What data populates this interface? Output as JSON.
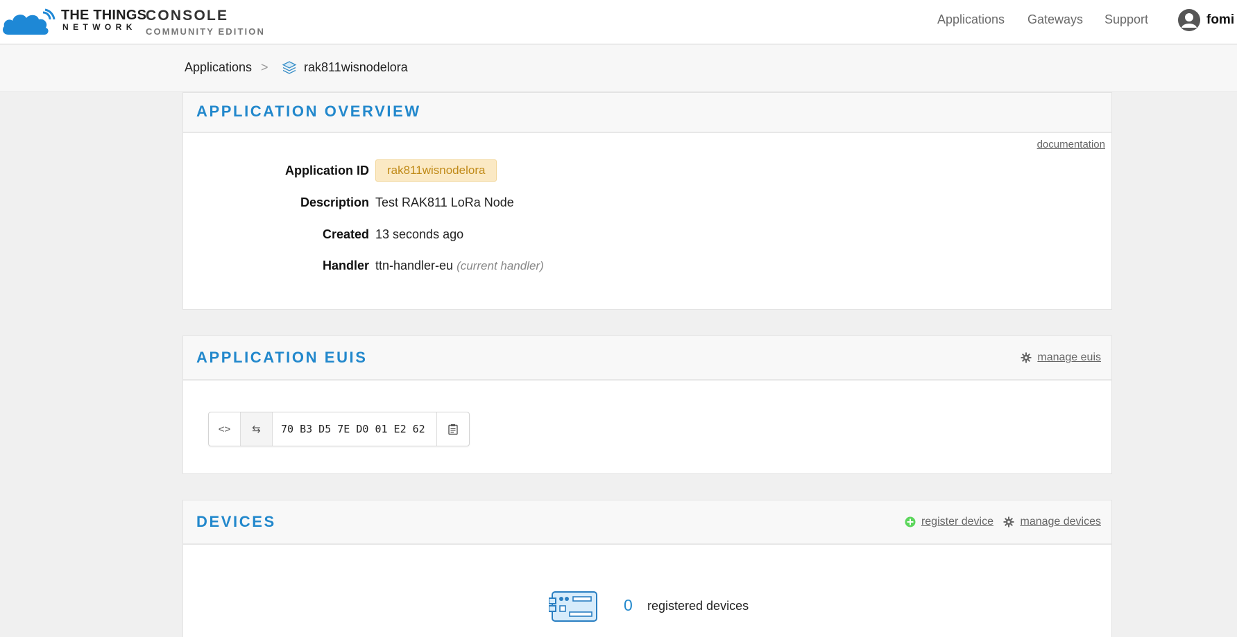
{
  "brand": {
    "line1": "THE THINGS",
    "line2": "NETWORK",
    "console": "CONSOLE",
    "edition": "COMMUNITY EDITION",
    "logo_icon": "cloud-icon"
  },
  "nav": {
    "items": [
      "Applications",
      "Gateways",
      "Support"
    ],
    "user": "fomi",
    "user_icon": "user-avatar-icon"
  },
  "breadcrumb": {
    "root": "Applications",
    "separator": ">",
    "current": "rak811wisnodelora",
    "current_icon": "layers-icon"
  },
  "overview": {
    "title": "APPLICATION OVERVIEW",
    "documentation": "documentation",
    "fields": {
      "app_id_label": "Application ID",
      "app_id": "rak811wisnodelora",
      "description_label": "Description",
      "description": "Test RAK811 LoRa Node",
      "created_label": "Created",
      "created": "13 seconds ago",
      "handler_label": "Handler",
      "handler": "ttn-handler-eu",
      "handler_note": "(current handler)"
    }
  },
  "euis": {
    "title": "APPLICATION EUIS",
    "manage": "manage euis",
    "toggle_format_glyph": "<>",
    "swap_glyph": "⇆",
    "value": "70 B3 D5 7E D0 01 E2 62",
    "copy_icon": "clipboard-icon"
  },
  "devices": {
    "title": "DEVICES",
    "register": "register device",
    "manage": "manage devices",
    "count": "0",
    "count_label": "registered devices"
  },
  "colors": {
    "accent": "#2288cc",
    "badge_bg": "#fbe9c4",
    "badge_text": "#c08a18",
    "add_green": "#5cd65c"
  }
}
